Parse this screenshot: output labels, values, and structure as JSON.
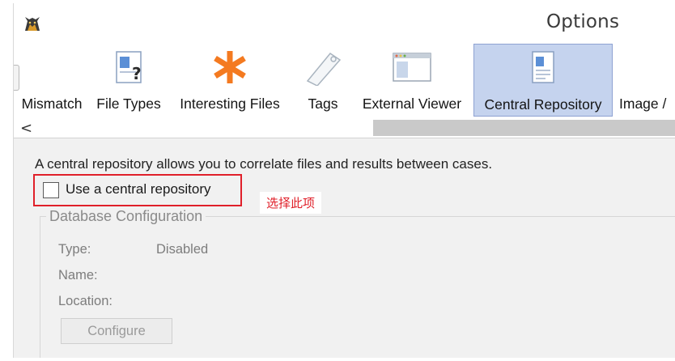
{
  "window": {
    "title": "Options"
  },
  "toolbar": {
    "tabs": [
      {
        "label": "Mismatch"
      },
      {
        "label": "File Types"
      },
      {
        "label": "Interesting Files"
      },
      {
        "label": "Tags"
      },
      {
        "label": "External Viewer"
      },
      {
        "label": "Central Repository",
        "selected": true
      },
      {
        "label": "Image /"
      }
    ]
  },
  "scrollbar": {
    "left_arrow": "<"
  },
  "panel": {
    "description": "A central repository allows you to correlate files and results between cases.",
    "use_cr_checkbox": {
      "label": "Use a central repository",
      "checked": false
    },
    "annotation": "选择此项",
    "db_config": {
      "title": "Database Configuration",
      "type_label": "Type:",
      "type_value": "Disabled",
      "name_label": "Name:",
      "location_label": "Location:",
      "configure_button": "Configure"
    }
  },
  "colors": {
    "selected_tab_bg": "#c5d3ee",
    "highlight_border": "#e0202a",
    "annotation_text": "#e0202a",
    "asterisk_orange": "#f47a20"
  }
}
